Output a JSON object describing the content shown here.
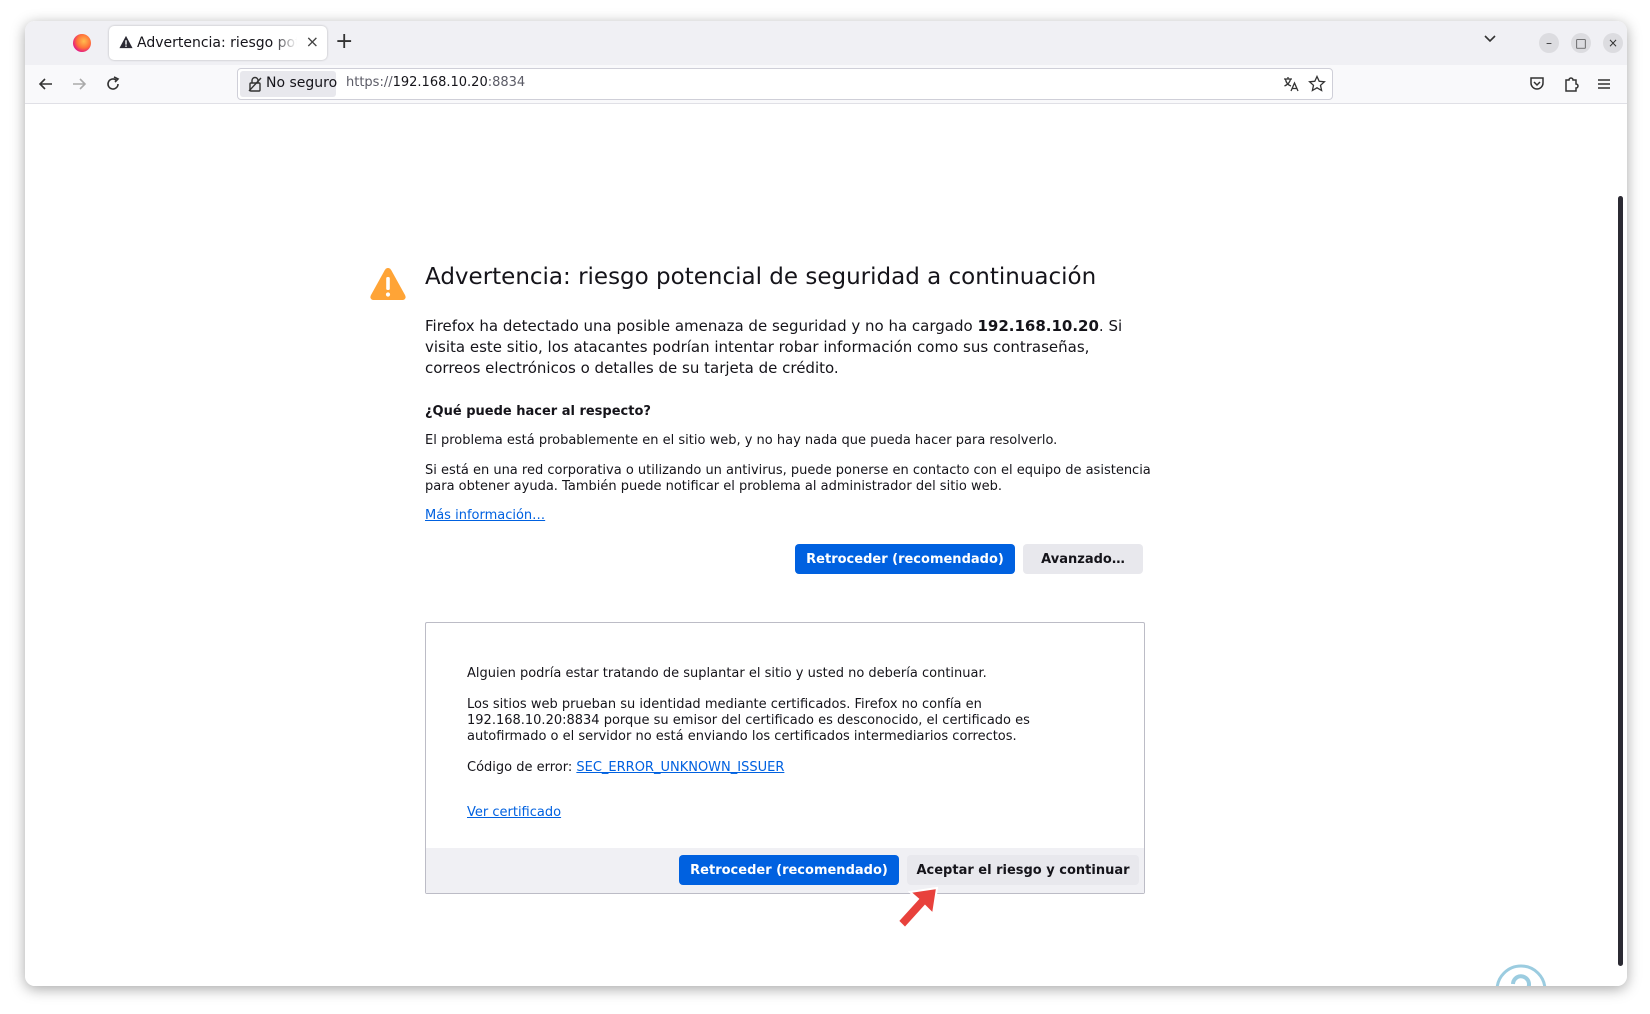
{
  "tab": {
    "title": "Advertencia: riesgo potencial de seguridad a continuación",
    "new_tab_label": "+",
    "close_label": "×"
  },
  "window_controls": {
    "minimize": "–",
    "maximize": "□",
    "close": "×"
  },
  "urlbar": {
    "identity_label": "No seguro",
    "url_scheme": "https://",
    "url_host": "192.168.10.20",
    "url_port": ":8834"
  },
  "error_page": {
    "title": "Advertencia: riesgo potencial de seguridad a continuación",
    "lead_before": "Firefox ha detectado una posible amenaza de seguridad y no ha cargado ",
    "lead_host": "192.168.10.20",
    "lead_after": ". Si visita este sitio, los atacantes podrían intentar robar información como sus contraseñas, correos electrónicos o detalles de su tarjeta de crédito.",
    "question": "¿Qué puede hacer al respecto?",
    "paragraph1": "El problema está probablemente en el sitio web, y no hay nada que pueda hacer para resolverlo.",
    "paragraph2": "Si está en una red corporativa o utilizando un antivirus, puede ponerse en contacto con el equipo de asistencia para obtener ayuda. También puede notificar el problema al administrador del sitio web.",
    "more_info_link": "Más información…",
    "go_back_button": "Retroceder (recomendado)",
    "advanced_button": "Avanzado…"
  },
  "advanced_panel": {
    "text1": "Alguien podría estar tratando de suplantar el sitio y usted no debería continuar.",
    "text2": "Los sitios web prueban su identidad mediante certificados. Firefox no confía en 192.168.10.20:8834 porque su emisor del certificado es desconocido, el certificado es autofirmado o el servidor no está enviando los certificados intermediarios correctos.",
    "error_code_label": "Código de error: ",
    "error_code": "SEC_ERROR_UNKNOWN_ISSUER",
    "view_certificate_link": "Ver certificado",
    "go_back_button": "Retroceder (recomendado)",
    "accept_button": "Aceptar el riesgo y continuar"
  },
  "colors": {
    "primary_button": "#0061e0",
    "warning_icon": "#ffa436",
    "annotation_arrow": "#e8413c"
  }
}
